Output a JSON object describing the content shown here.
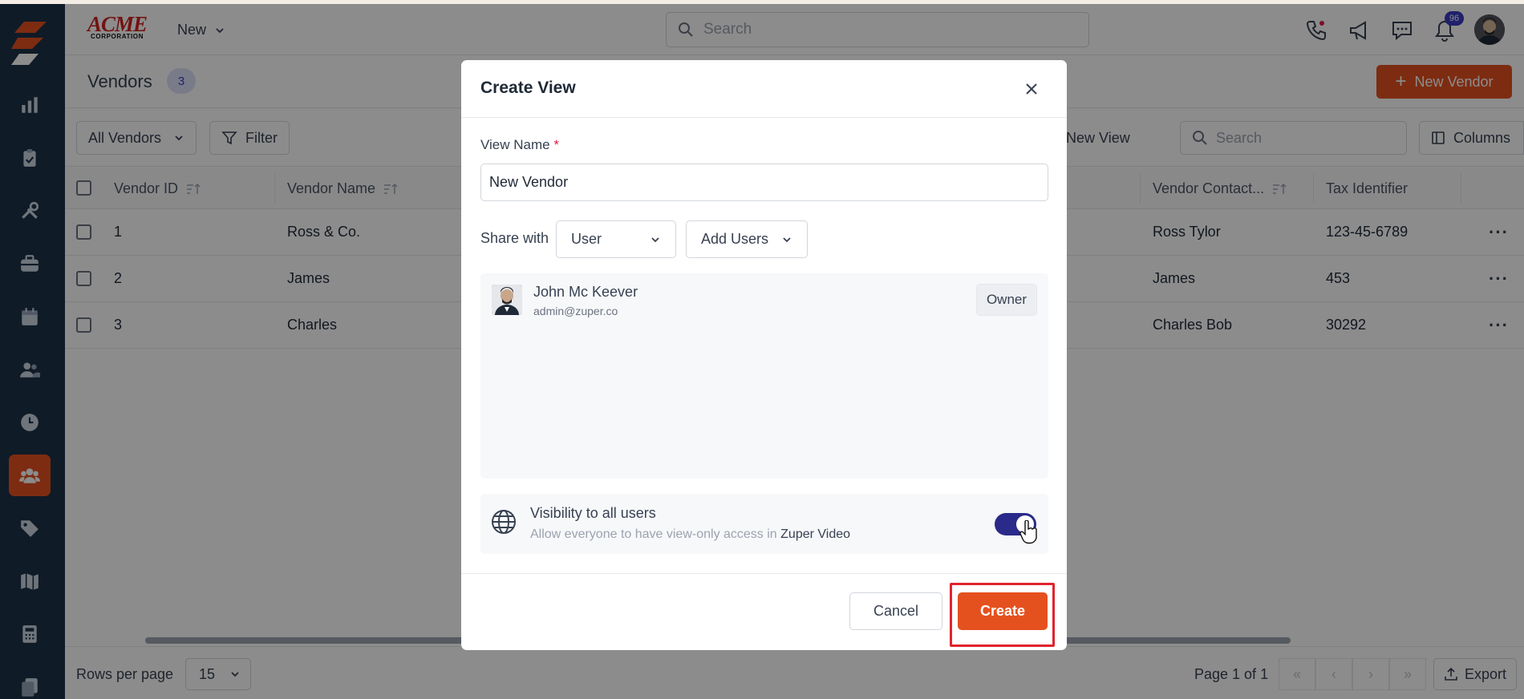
{
  "brand": {
    "name": "ACME",
    "sub": "CORPORATION"
  },
  "header": {
    "new_menu_label": "New",
    "search_placeholder": "Search",
    "notification_count": "96"
  },
  "sidebar": {
    "items": [
      "reports",
      "work-orders",
      "tools",
      "inventory",
      "calendar",
      "customers",
      "timesheets",
      "vendors",
      "tags",
      "maps",
      "calculator",
      "documents"
    ],
    "active": "vendors"
  },
  "page": {
    "title": "Vendors",
    "count": "3",
    "new_button": "New Vendor"
  },
  "toolbar": {
    "view_select": "All Vendors",
    "filter_label": "Filter",
    "create_view_label": "ate New View",
    "search_placeholder": "Search",
    "columns_label": "Columns"
  },
  "table": {
    "columns": [
      "Vendor ID",
      "Vendor Name",
      "Vendor Contact...",
      "Tax Identifier"
    ],
    "rows": [
      {
        "id": "1",
        "name": "Ross & Co.",
        "contact": "Ross Tylor",
        "tax": "123-45-6789"
      },
      {
        "id": "2",
        "name": "James",
        "contact": "James",
        "tax": "453"
      },
      {
        "id": "3",
        "name": "Charles",
        "contact": "Charles Bob",
        "tax": "30292"
      }
    ]
  },
  "footer": {
    "rows_per_page_label": "Rows per page",
    "rows_per_page_value": "15",
    "page_info": "Page 1 of 1",
    "export_label": "Export"
  },
  "modal": {
    "title": "Create View",
    "view_name_label": "View Name",
    "required_mark": "*",
    "view_name_value": "New Vendor",
    "share_with_label": "Share with",
    "share_type": "User",
    "add_users_label": "Add Users",
    "user": {
      "name": "John Mc Keever",
      "email": "admin@zuper.co",
      "role": "Owner"
    },
    "visibility_title": "Visibility to all users",
    "visibility_desc": "Allow everyone to have view-only access in",
    "visibility_app": "Zuper Video",
    "visibility_enabled": true,
    "cancel_label": "Cancel",
    "create_label": "Create"
  },
  "colors": {
    "accent": "#e4511f",
    "sidebar": "#1d3247",
    "toggle_on": "#2a2a8a",
    "badge": "#3b3bc4",
    "highlight": "#e0242e"
  }
}
